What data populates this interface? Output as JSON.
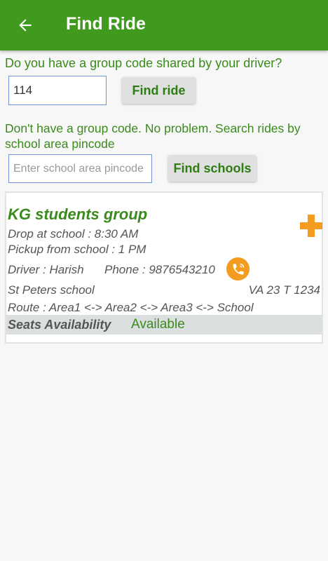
{
  "header": {
    "title": "Find Ride",
    "back_icon": "arrow-left-icon",
    "color": "#3f9a1e"
  },
  "group_code": {
    "question": "Do you have a group code shared by your driver?",
    "value": "114",
    "button_label": "Find ride"
  },
  "pincode": {
    "question": "Don't have a group code. No problem. Search rides by school area pincode",
    "placeholder": "Enter school area pincode",
    "value": "",
    "button_label": "Find schools"
  },
  "ride_card": {
    "group_name": "KG students group",
    "drop": "Drop at school : 8:30 AM",
    "pickup": "Pickup from school : 1 PM",
    "driver": "Driver : Harish",
    "phone": "Phone : 9876543210",
    "school": "St Peters school",
    "vehicle": "VA 23 T 1234",
    "route": "Route : Area1 <-> Area2 <-> Area3 <-> School",
    "seats_label": "Seats Availability",
    "seats_value": "Available",
    "call_icon": "phone-call-icon",
    "add_icon": "plus-icon",
    "accent_color": "#f39c1f"
  }
}
